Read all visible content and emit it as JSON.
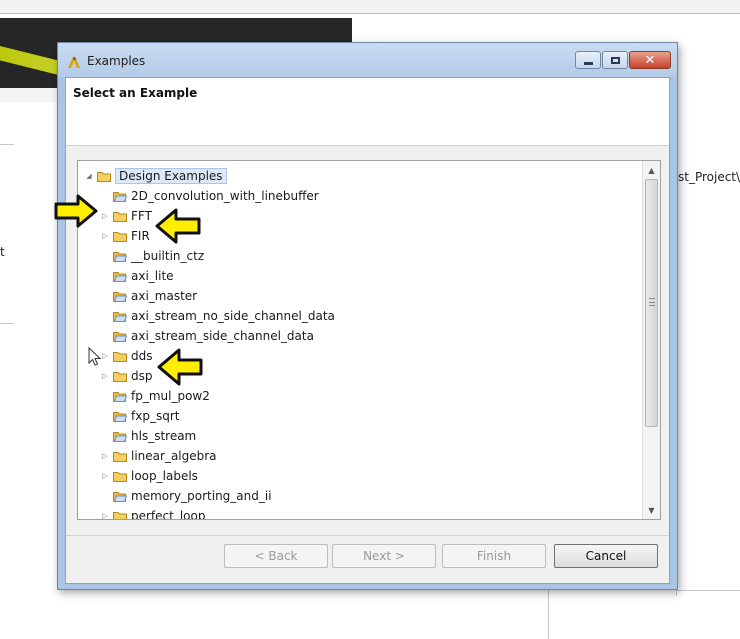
{
  "background": {
    "left_text": "t",
    "right_text": "st_Project\\r"
  },
  "dialog": {
    "title": "Examples",
    "header_title": "Select an Example",
    "tree": {
      "root_label": "Design Examples",
      "items": [
        {
          "label": "2D_convolution_with_linebuffer",
          "expandable": false
        },
        {
          "label": "FFT",
          "expandable": true
        },
        {
          "label": "FIR",
          "expandable": true
        },
        {
          "label": "__builtin_ctz",
          "expandable": false
        },
        {
          "label": "axi_lite",
          "expandable": false
        },
        {
          "label": "axi_master",
          "expandable": false
        },
        {
          "label": "axi_stream_no_side_channel_data",
          "expandable": false
        },
        {
          "label": "axi_stream_side_channel_data",
          "expandable": false
        },
        {
          "label": "dds",
          "expandable": true
        },
        {
          "label": "dsp",
          "expandable": true
        },
        {
          "label": "fp_mul_pow2",
          "expandable": false
        },
        {
          "label": "fxp_sqrt",
          "expandable": false
        },
        {
          "label": "hls_stream",
          "expandable": false
        },
        {
          "label": "linear_algebra",
          "expandable": true
        },
        {
          "label": "loop_labels",
          "expandable": true
        },
        {
          "label": "memory_porting_and_ii",
          "expandable": false
        },
        {
          "label": "perfect_loop",
          "expandable": true
        }
      ]
    },
    "buttons": {
      "back": "< Back",
      "next": "Next >",
      "finish": "Finish",
      "cancel": "Cancel"
    }
  },
  "colors": {
    "highlight_arrow": "#ffee00",
    "title_bar": "#b3cbe8",
    "selection": "#dce8f7"
  }
}
